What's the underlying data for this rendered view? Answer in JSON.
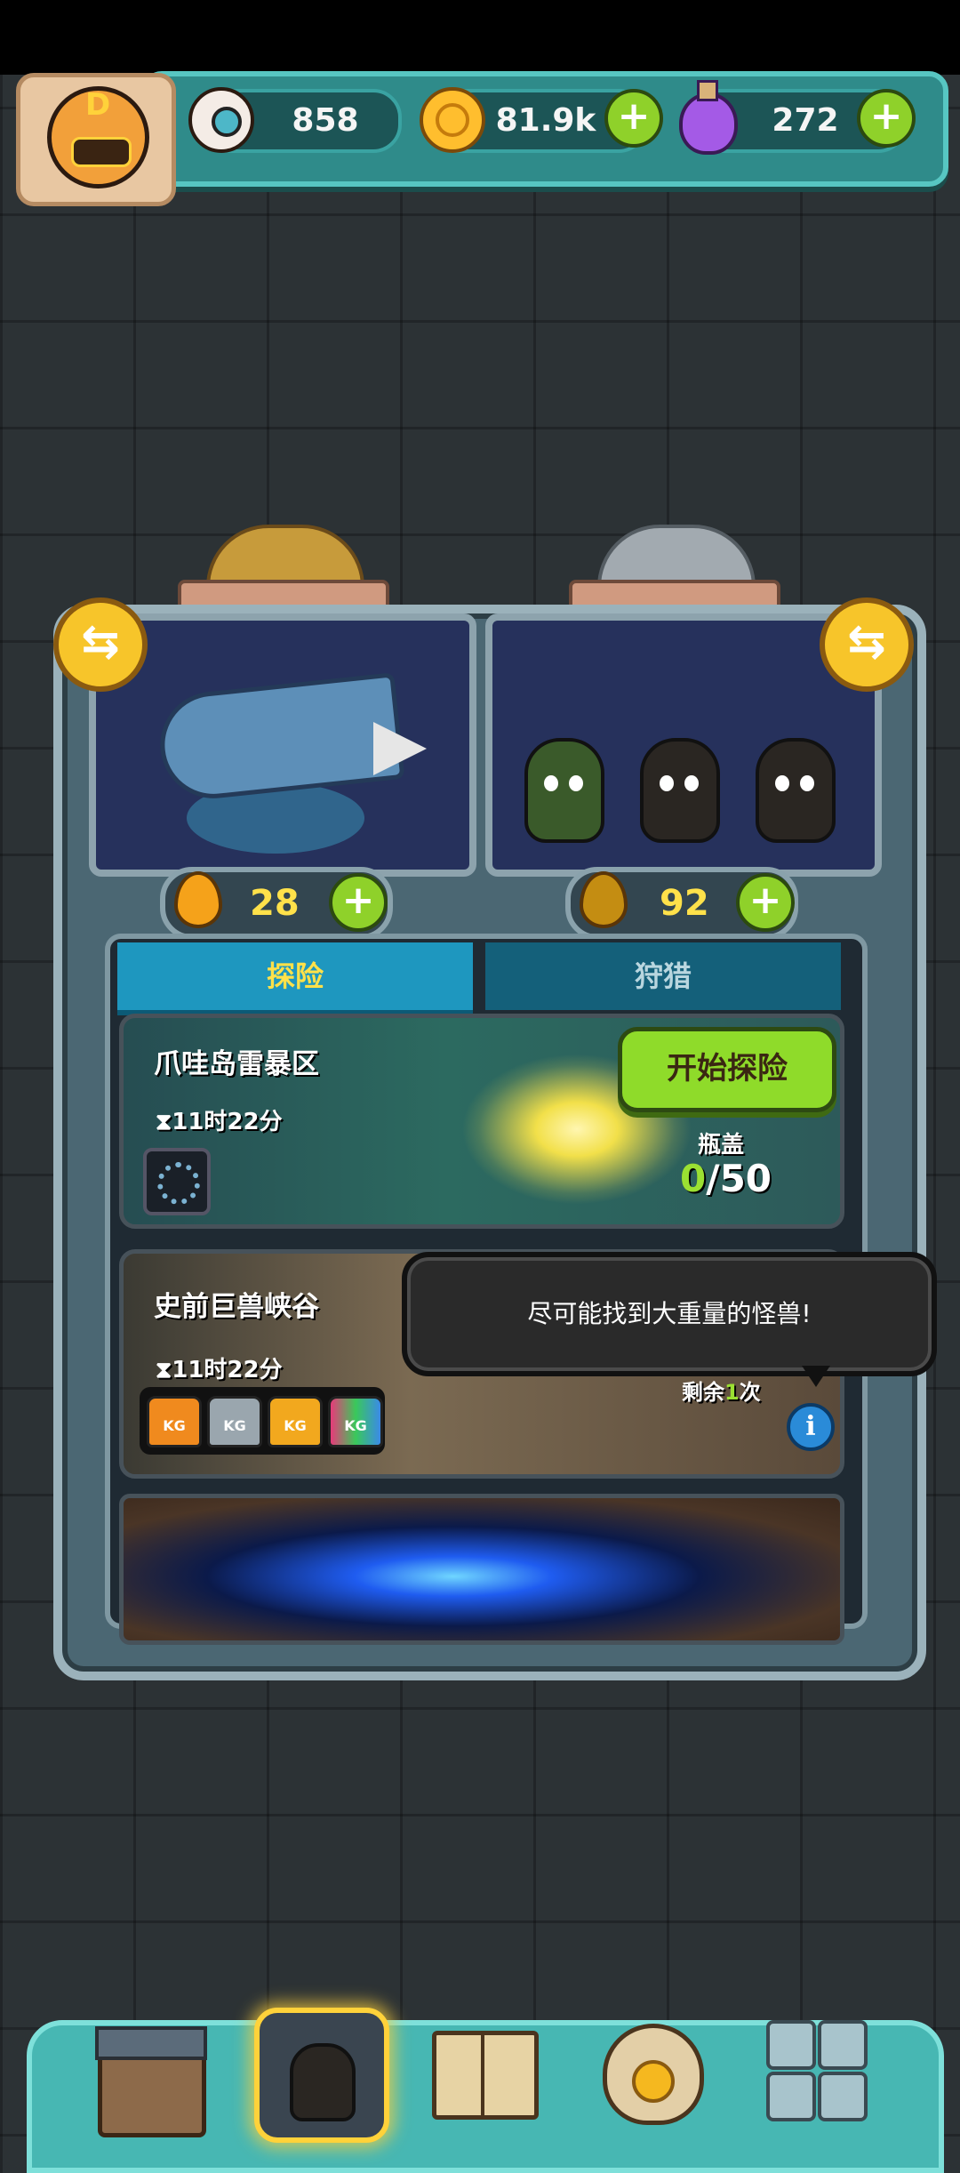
{
  "resources": {
    "eyes": "858",
    "coins": "81.9k",
    "potions": "272",
    "add_symbol": "+"
  },
  "profile": {
    "rank_letter": "D"
  },
  "machine": {
    "swap_symbol": "⇆",
    "left_energy": "28",
    "right_energy": "92"
  },
  "tabs": [
    {
      "label": "探险",
      "active": true
    },
    {
      "label": "狩猎",
      "active": false
    }
  ],
  "expeditions": [
    {
      "name": "爪哇岛雷暴区",
      "timer": "⧗11时22分",
      "action_label": "开始探险",
      "bottle_label": "瓶盖",
      "bottle_current": "0",
      "bottle_total": "/50"
    },
    {
      "name": "史前巨兽峡谷",
      "timer": "⧗11时22分",
      "kg_labels": [
        "KG",
        "KG",
        "KG",
        "KG"
      ],
      "remaining_prefix": "剩余",
      "remaining_count": "1",
      "remaining_suffix": "次"
    }
  ],
  "tooltip": {
    "text": "尽可能找到大重量的怪兽!"
  },
  "info_symbol": "i",
  "colors": {
    "accent_green": "#8fdb2a",
    "energy_yellow": "#ffe14a",
    "tab_active": "#1e97bf",
    "teal_bar": "#2f8b8a"
  },
  "icons": [
    "eyeball-icon",
    "coin-icon",
    "potion-icon",
    "plus-icon",
    "swap-icon",
    "energy-drop-icon",
    "info-icon",
    "shop-icon",
    "creature-icon",
    "book-icon",
    "money-bag-icon",
    "grid-icon"
  ]
}
